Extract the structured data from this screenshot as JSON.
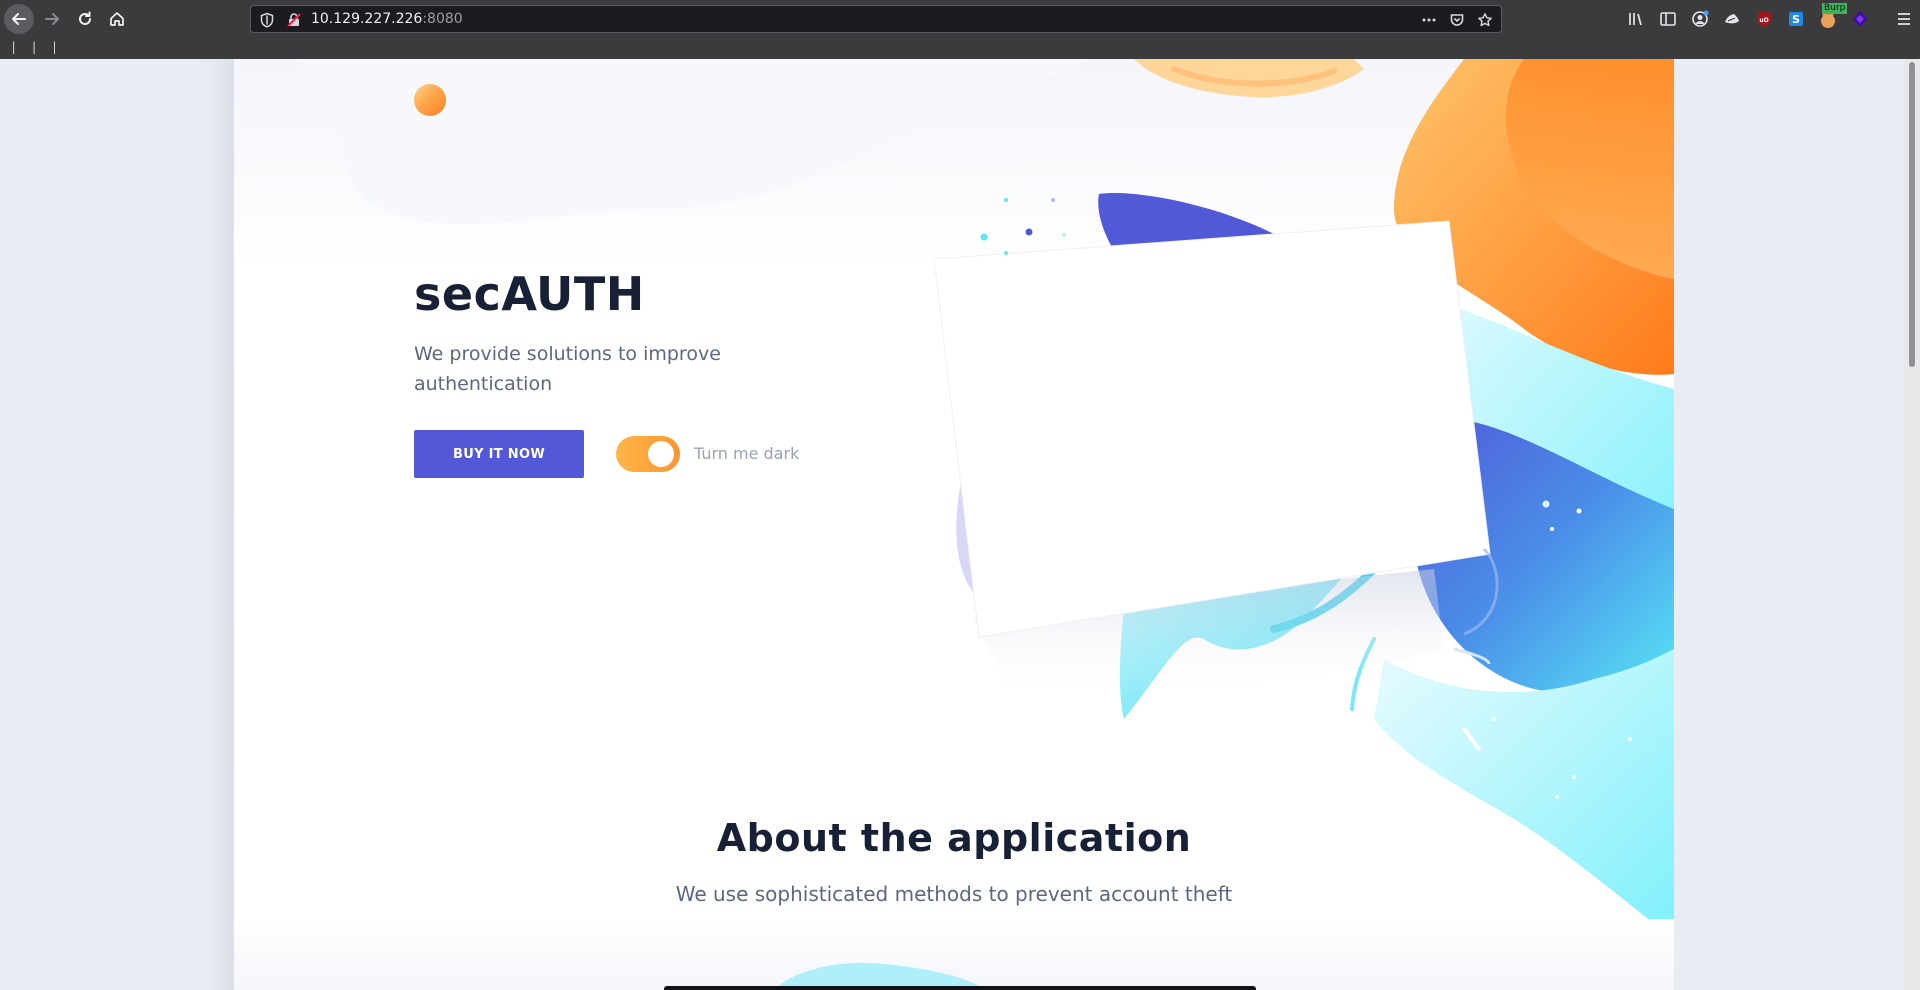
{
  "browser": {
    "url_host": "10.129.227.226",
    "url_port": ":8080",
    "bookmarks_toolbar_text": "| | |",
    "extension_badge": "Burp"
  },
  "page": {
    "hero": {
      "title": "secAUTH",
      "subtitle": "We provide solutions to improve authentication",
      "cta_label": "BUY IT NOW",
      "toggle_label": "Turn me dark",
      "toggle_on": true
    },
    "about": {
      "title": "About the application",
      "subtitle": "We use sophisticated methods to prevent account theft"
    }
  },
  "colors": {
    "accent": "#5359d6",
    "heading": "#172035",
    "body_text": "#5c6780",
    "toggle": "#ffa53c",
    "orange": "#ff8a24",
    "cyan": "#5ee6f7",
    "blue": "#4a66e0"
  }
}
